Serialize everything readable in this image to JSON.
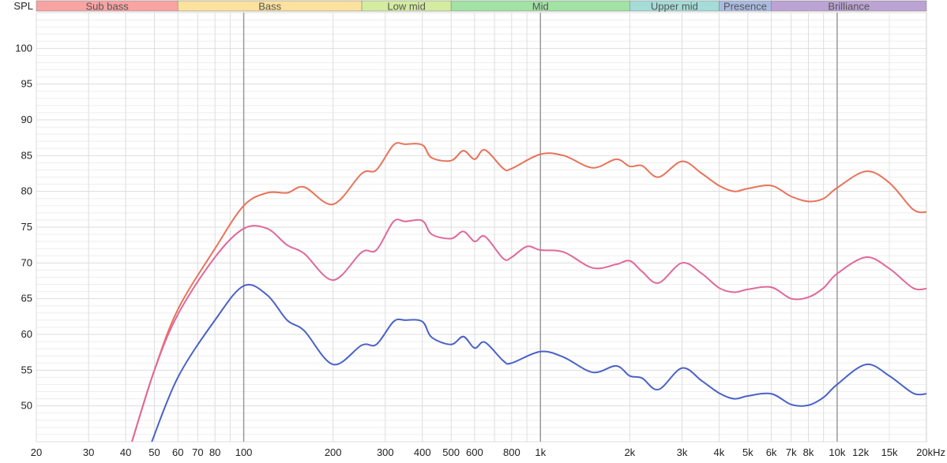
{
  "chart_data": {
    "type": "line",
    "title": "",
    "ylabel": "SPL",
    "xlabel": "Hz",
    "xscale": "log",
    "xlim": [
      20,
      20000
    ],
    "ylim": [
      45,
      105
    ],
    "grid": true,
    "y_ticks": [
      50,
      55,
      60,
      65,
      70,
      75,
      80,
      85,
      90,
      95,
      100
    ],
    "x_ticks": [
      {
        "value": 20,
        "label": "20"
      },
      {
        "value": 30,
        "label": "30"
      },
      {
        "value": 40,
        "label": "40"
      },
      {
        "value": 50,
        "label": "50"
      },
      {
        "value": 60,
        "label": "60"
      },
      {
        "value": 70,
        "label": "70"
      },
      {
        "value": 80,
        "label": "80"
      },
      {
        "value": 100,
        "label": "100"
      },
      {
        "value": 200,
        "label": "200"
      },
      {
        "value": 300,
        "label": "300"
      },
      {
        "value": 400,
        "label": "400"
      },
      {
        "value": 500,
        "label": "500"
      },
      {
        "value": 600,
        "label": "600"
      },
      {
        "value": 800,
        "label": "800"
      },
      {
        "value": 1000,
        "label": "1k"
      },
      {
        "value": 2000,
        "label": "2k"
      },
      {
        "value": 3000,
        "label": "3k"
      },
      {
        "value": 4000,
        "label": "4k"
      },
      {
        "value": 5000,
        "label": "5k"
      },
      {
        "value": 6000,
        "label": "6k"
      },
      {
        "value": 7000,
        "label": "7k"
      },
      {
        "value": 8000,
        "label": "8k"
      },
      {
        "value": 10000,
        "label": "10k"
      },
      {
        "value": 12000,
        "label": "12k",
        "muted": true
      },
      {
        "value": 15000,
        "label": "15k",
        "muted": true
      },
      {
        "value": 20000,
        "label": "20kHz"
      }
    ],
    "bands": [
      {
        "label": "Sub bass",
        "from": 20,
        "to": 60,
        "color": "#f9a3a3"
      },
      {
        "label": "Bass",
        "from": 60,
        "to": 250,
        "color": "#fbe29e"
      },
      {
        "label": "Low mid",
        "from": 250,
        "to": 500,
        "color": "#d4eca0"
      },
      {
        "label": "Mid",
        "from": 500,
        "to": 2000,
        "color": "#a2e2a4"
      },
      {
        "label": "Upper mid",
        "from": 2000,
        "to": 4000,
        "color": "#a4dcd8"
      },
      {
        "label": "Presence",
        "from": 4000,
        "to": 6000,
        "color": "#aabbe2"
      },
      {
        "label": "Brilliance",
        "from": 6000,
        "to": 20000,
        "color": "#bba3d3"
      }
    ],
    "series": [
      {
        "name": "red",
        "color": "#e8735a",
        "x": [
          42,
          50,
          60,
          80,
          100,
          120,
          140,
          160,
          200,
          250,
          280,
          320,
          350,
          400,
          430,
          500,
          550,
          600,
          650,
          750,
          800,
          1000,
          1200,
          1500,
          1800,
          2000,
          2200,
          2500,
          3000,
          3500,
          4000,
          4500,
          5000,
          6000,
          7000,
          8000,
          9000,
          10000,
          12500,
          15000,
          18000,
          20000
        ],
        "y": [
          45,
          55,
          63.5,
          72,
          78,
          79.8,
          79.8,
          80.6,
          78.2,
          82.5,
          83,
          86.5,
          86.6,
          86.5,
          84.7,
          84.3,
          85.7,
          84.5,
          85.8,
          83.2,
          83.2,
          85.2,
          85,
          83.3,
          84.5,
          83.5,
          83.6,
          82,
          84.2,
          82.5,
          80.8,
          80,
          80.4,
          80.8,
          79.3,
          78.6,
          79,
          80.5,
          82.8,
          81.2,
          77.5,
          77.1
        ]
      },
      {
        "name": "pink",
        "color": "#e0699a",
        "x": [
          42,
          50,
          60,
          80,
          100,
          120,
          140,
          160,
          200,
          250,
          280,
          320,
          350,
          400,
          430,
          500,
          550,
          600,
          650,
          750,
          800,
          900,
          1000,
          1200,
          1500,
          1800,
          2000,
          2200,
          2500,
          3000,
          3500,
          4000,
          4500,
          5000,
          6000,
          7000,
          8000,
          9000,
          10000,
          12500,
          15000,
          18000,
          20000
        ],
        "y": [
          45,
          55,
          62.8,
          70.8,
          74.8,
          74.8,
          72.5,
          71.3,
          67.6,
          71.5,
          71.8,
          75.8,
          75.8,
          75.9,
          74,
          73.4,
          74.4,
          73,
          73.7,
          70.6,
          70.8,
          72.3,
          71.8,
          71.5,
          69.3,
          69.8,
          70.3,
          68.8,
          67.2,
          70,
          68.5,
          66.5,
          65.9,
          66.3,
          66.6,
          65,
          65.2,
          66.5,
          68.5,
          70.8,
          69.2,
          66.5,
          66.4
        ]
      },
      {
        "name": "blue",
        "color": "#4a62c8",
        "x": [
          49,
          60,
          80,
          100,
          120,
          140,
          160,
          200,
          250,
          280,
          320,
          350,
          400,
          430,
          500,
          550,
          600,
          650,
          750,
          800,
          1000,
          1200,
          1500,
          1800,
          2000,
          2200,
          2500,
          3000,
          3500,
          4000,
          4500,
          5000,
          6000,
          7000,
          8000,
          9000,
          10000,
          12500,
          15000,
          18000,
          20000
        ],
        "y": [
          45,
          54,
          62,
          66.8,
          65.5,
          62,
          60.5,
          55.8,
          58.5,
          58.6,
          61.8,
          62,
          61.8,
          59.6,
          58.6,
          59.7,
          58.1,
          58.9,
          56.3,
          56,
          57.6,
          56.8,
          54.7,
          55.6,
          54.2,
          53.9,
          52.3,
          55.3,
          53.5,
          51.8,
          51,
          51.4,
          51.7,
          50.2,
          50.1,
          51.2,
          53,
          55.8,
          54.2,
          51.8,
          51.7
        ]
      }
    ]
  }
}
